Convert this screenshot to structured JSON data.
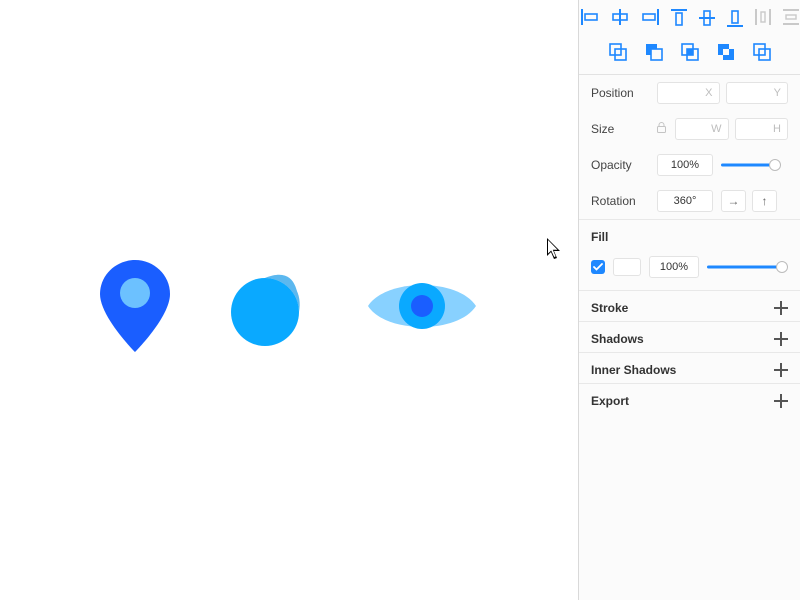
{
  "inspector": {
    "position": {
      "label": "Position",
      "x_placeholder": "X",
      "y_placeholder": "Y"
    },
    "size": {
      "label": "Size",
      "w_placeholder": "W",
      "h_placeholder": "H"
    },
    "opacity": {
      "label": "Opacity",
      "value": "100%"
    },
    "rotation": {
      "label": "Rotation",
      "value": "360°",
      "flip_h": "→",
      "flip_v": "↑"
    },
    "sections": {
      "fill": "Fill",
      "stroke": "Stroke",
      "shadows": "Shadows",
      "inner_shadows": "Inner Shadows",
      "export": "Export"
    },
    "fill": {
      "enabled": true,
      "opacity": "100%"
    }
  },
  "colors": {
    "accent": "#1e88ff",
    "pin_outer": "#1a5eff",
    "pin_inner": "#6cc1ff",
    "drop_body": "#0aa9ff",
    "drop_fold": "#5cb8ef",
    "eye_outer": "#88d1ff",
    "eye_mid": "#0aa9ff",
    "eye_pupil": "#1a5eff"
  }
}
